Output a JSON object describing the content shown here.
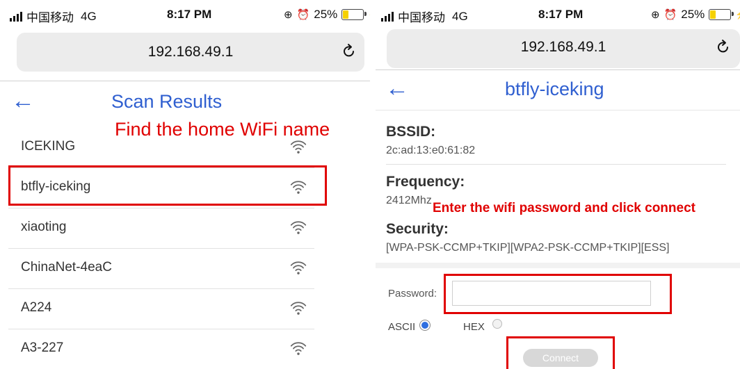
{
  "status": {
    "carrier": "中国移动",
    "network": "4G",
    "time": "8:17 PM",
    "battery": "25%"
  },
  "browser": {
    "url": "192.168.49.1"
  },
  "scan": {
    "title": "Scan Results",
    "annotation": "Find the home WiFi name",
    "networks": [
      "ICEKING",
      "btfly-iceking",
      "xiaoting",
      "ChinaNet-4eaC",
      "A224",
      "A3-227"
    ]
  },
  "detail": {
    "title": "btfly-iceking",
    "bssid_label": "BSSID:",
    "bssid": "2c:ad:13:e0:61:82",
    "frequency_label": "Frequency:",
    "frequency": "2412Mhz",
    "security_label": "Security:",
    "security": "[WPA-PSK-CCMP+TKIP][WPA2-PSK-CCMP+TKIP][ESS]",
    "annotation": "Enter the wifi password and click connect",
    "password_label": "Password:",
    "password_value": "",
    "ascii_label": "ASCII",
    "hex_label": "HEX",
    "connect_label": "Connect"
  },
  "colors": {
    "accent": "#2f5fd0",
    "annotation": "#e00000"
  }
}
